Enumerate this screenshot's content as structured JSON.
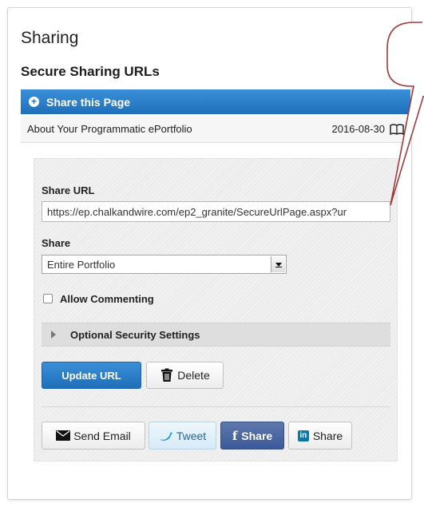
{
  "header": {
    "title": "Sharing",
    "subtitle": "Secure Sharing URLs",
    "share_page_label": "Share this Page"
  },
  "url_item": {
    "name": "About Your Programmatic ePortfolio",
    "date": "2016-08-30"
  },
  "form": {
    "share_url_label": "Share URL",
    "share_url_value": "https://ep.chalkandwire.com/ep2_granite/SecureUrlPage.aspx?ur",
    "share_label": "Share",
    "share_selected": "Entire Portfolio",
    "allow_commenting_label": "Allow Commenting",
    "allow_commenting_checked": false,
    "optional_security_label": "Optional Security Settings"
  },
  "actions": {
    "update_label": "Update URL",
    "delete_label": "Delete"
  },
  "social": {
    "email_label": "Send Email",
    "tweet_label": "Tweet",
    "facebook_label": "Share",
    "linkedin_label": "Share"
  },
  "colors": {
    "accent_blue": "#1f6fba",
    "facebook_blue": "#3b5998",
    "linkedin_blue": "#0e76a8",
    "callout_border": "#a23a3a"
  }
}
